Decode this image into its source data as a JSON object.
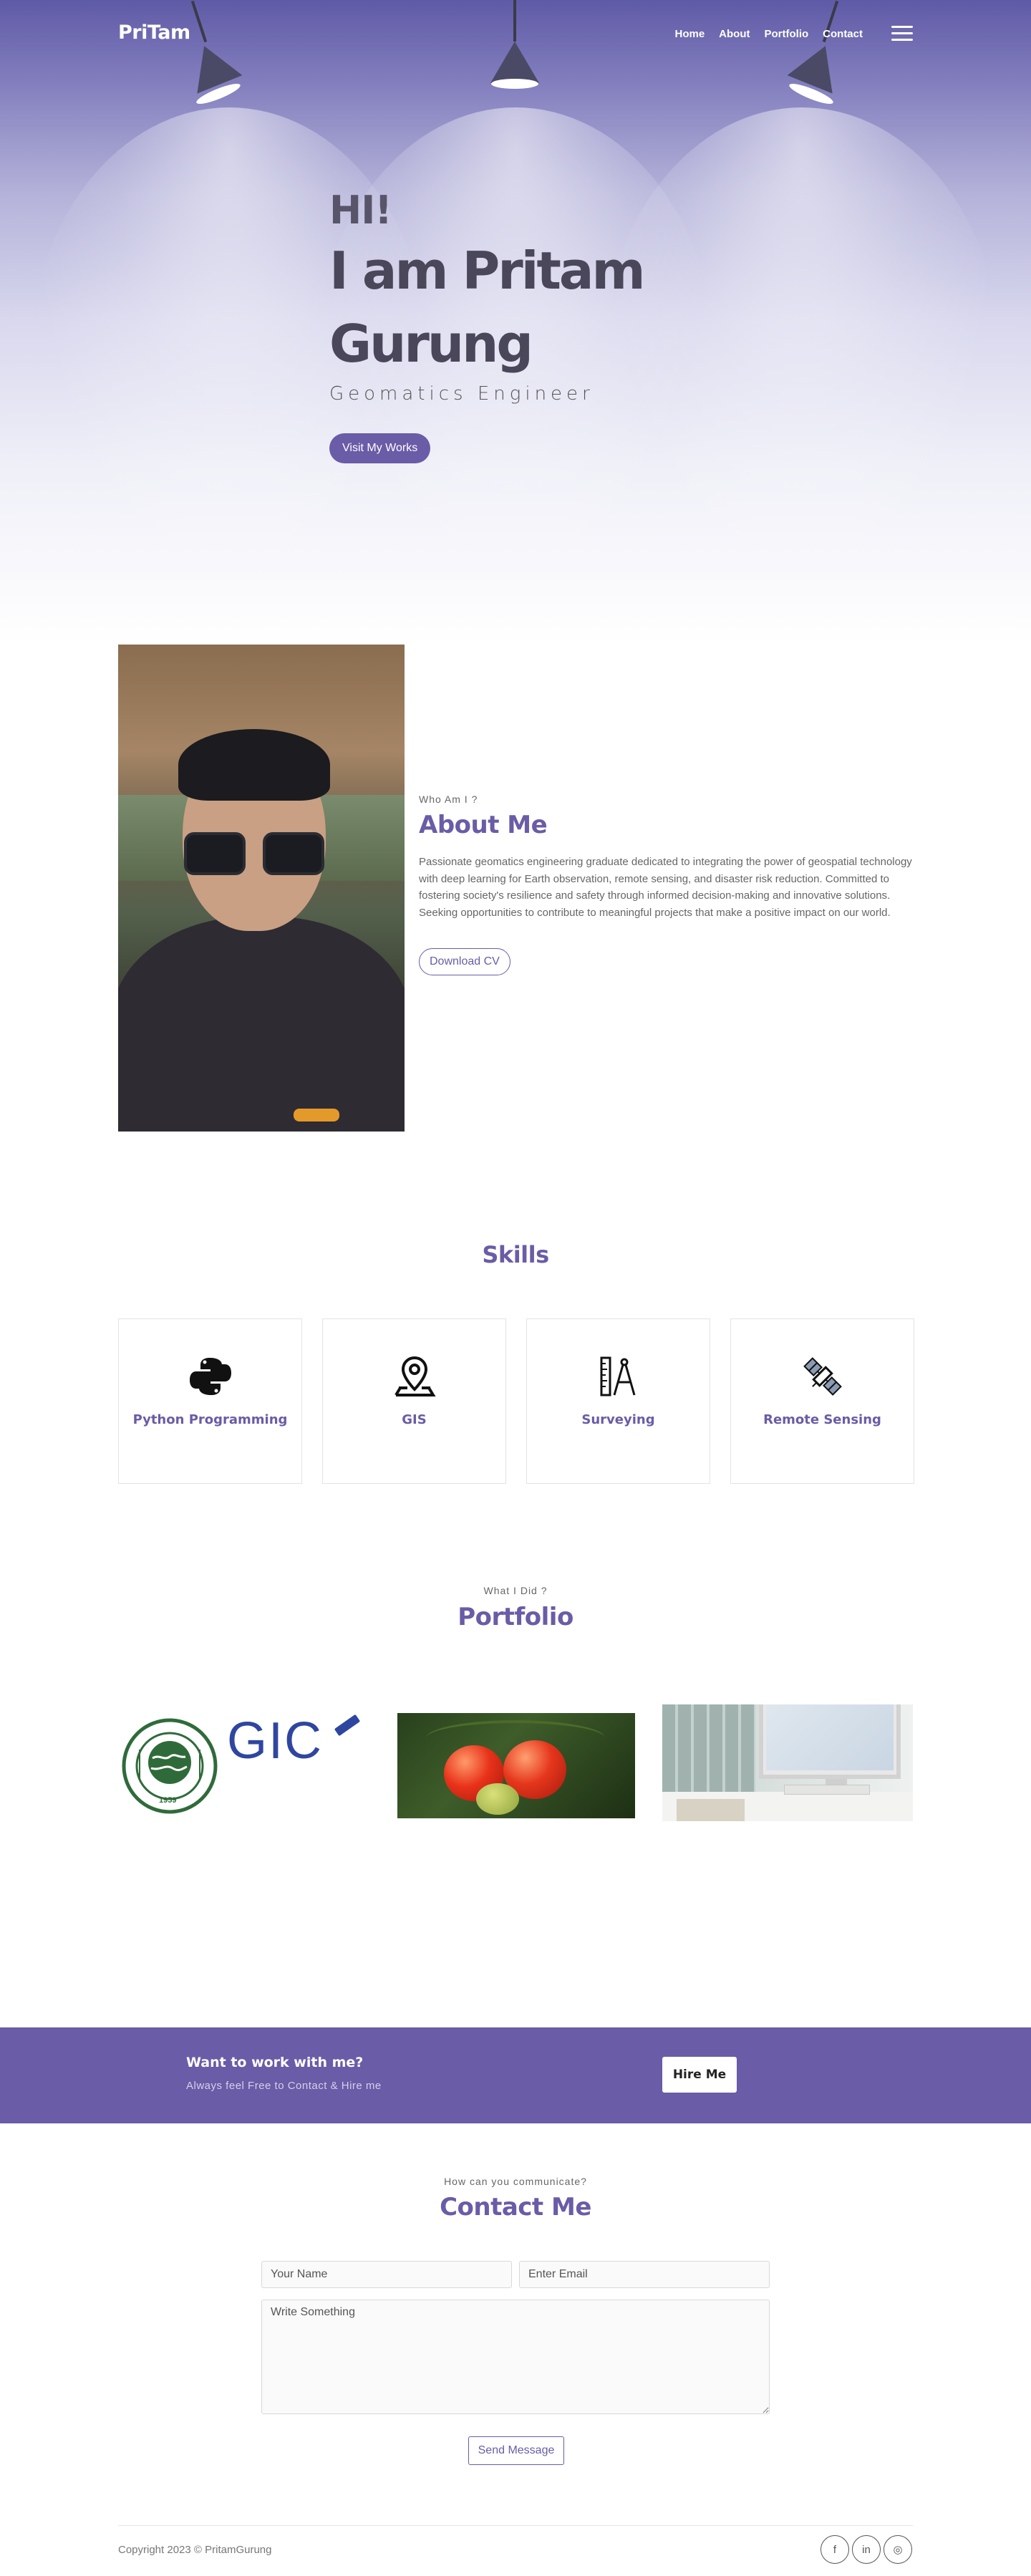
{
  "nav": {
    "brand": "PriTam",
    "links": [
      "Home",
      "About",
      "Portfolio",
      "Contact"
    ]
  },
  "hero": {
    "greeting": "HI!",
    "name_line1": "I am Pritam",
    "name_line2": "Gurung",
    "role": "Geomatics Engineer",
    "cta": "Visit My Works"
  },
  "about": {
    "kicker": "Who Am I ?",
    "title": "About Me",
    "description": "Passionate geomatics engineering graduate dedicated to integrating the power of geospatial technology with deep learning for Earth observation, remote sensing, and disaster risk reduction. Committed to fostering society's resilience and safety through informed decision-making and innovative solutions. Seeking opportunities to contribute to meaningful projects that make a positive impact on our world.",
    "cv_button": "Download CV"
  },
  "skills": {
    "title": "Skills",
    "items": [
      {
        "label": "Python Programming",
        "icon": "python-icon"
      },
      {
        "label": "GIS",
        "icon": "map-pin-icon"
      },
      {
        "label": "Surveying",
        "icon": "ruler-compass-icon"
      },
      {
        "label": "Remote Sensing",
        "icon": "satellite-icon"
      }
    ]
  },
  "portfolio": {
    "kicker": "What I Did ?",
    "title": "Portfolio",
    "logo_text": "GIC",
    "seal_year": "1959",
    "seal_text": "ASIAN INSTITUTE OF TECHNOLOGY"
  },
  "hire": {
    "title": "Want to work with me?",
    "subtitle": "Always feel Free to Contact & Hire me",
    "button": "Hire Me"
  },
  "contact": {
    "kicker": "How can you communicate?",
    "title": "Contact Me",
    "name_placeholder": "Your Name",
    "email_placeholder": "Enter Email",
    "message_placeholder": "Write Something",
    "send_button": "Send Message"
  },
  "footer": {
    "copyright": "Copyright 2023 © PritamGurung",
    "social": [
      {
        "icon": "facebook-icon",
        "label": "f"
      },
      {
        "icon": "linkedin-icon",
        "label": "in"
      },
      {
        "icon": "instagram-icon",
        "label": "◎"
      }
    ]
  },
  "colors": {
    "accent": "#6a5ca6",
    "hero_top": "#5f5aa6"
  }
}
